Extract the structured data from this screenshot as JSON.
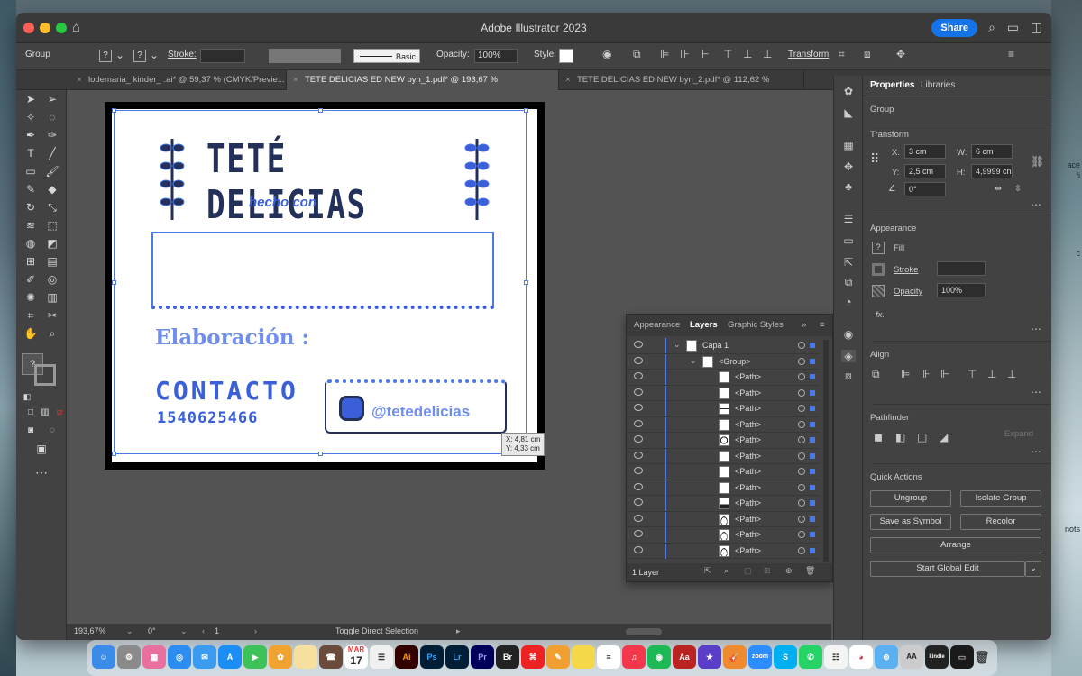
{
  "window": {
    "app_title": "Adobe Illustrator 2023",
    "share_label": "Share"
  },
  "control_bar": {
    "selection_label": "Group",
    "stroke_label": "Stroke:",
    "brush_label": "Basic",
    "opacity_label": "Opacity:",
    "opacity_value": "100%",
    "style_label": "Style:",
    "transform_label": "Transform"
  },
  "tabs": [
    {
      "label": "lodemaria_ kinder_ .ai* @ 59,37 % (CMYK/Previe...",
      "active": false
    },
    {
      "label": "TETE DELICIAS ED NEW byn_1.pdf* @ 193,67 % (CMYK/Preview)",
      "active": true
    },
    {
      "label": "TETE DELICIAS ED NEW byn_2.pdf* @ 112,62 % (CMYK/...",
      "active": false
    }
  ],
  "artwork": {
    "title": "TETÉ DELICIAS",
    "subtitle": "hecho con",
    "elaboracion": "Elaboración :",
    "contacto": "CONTACTO",
    "phone": "1540625466",
    "instagram": "@tetedelicias"
  },
  "cursor_tooltip": {
    "x": "X: 4,81 cm",
    "y": "Y: 4,33 cm"
  },
  "status_bar": {
    "zoom": "193,67%",
    "rotation": "0°",
    "artboard": "1",
    "tool_hint": "Toggle Direct Selection"
  },
  "layers_panel": {
    "tabs": [
      "Appearance",
      "Layers",
      "Graphic Styles"
    ],
    "active_tab": "Layers",
    "rows": [
      {
        "name": "Capa 1",
        "level": 0
      },
      {
        "name": "<Group>",
        "level": 1
      },
      {
        "name": "<Path>",
        "level": 2
      },
      {
        "name": "<Path>",
        "level": 2
      },
      {
        "name": "<Path>",
        "level": 2
      },
      {
        "name": "<Path>",
        "level": 2
      },
      {
        "name": "<Path>",
        "level": 2
      },
      {
        "name": "<Path>",
        "level": 2
      },
      {
        "name": "<Path>",
        "level": 2
      },
      {
        "name": "<Path>",
        "level": 2
      },
      {
        "name": "<Path>",
        "level": 2
      },
      {
        "name": "<Path>",
        "level": 2
      },
      {
        "name": "<Path>",
        "level": 2
      },
      {
        "name": "<Path>",
        "level": 2
      }
    ],
    "footer_label": "1 Layer"
  },
  "properties": {
    "tabs": [
      "Properties",
      "Libraries"
    ],
    "active_tab": "Properties",
    "object_type": "Group",
    "transform": {
      "title": "Transform",
      "x_label": "X:",
      "x_value": "3 cm",
      "y_label": "Y:",
      "y_value": "2,5 cm",
      "w_label": "W:",
      "w_value": "6 cm",
      "h_label": "H:",
      "h_value": "4,9999 cn",
      "angle_value": "0°"
    },
    "appearance": {
      "title": "Appearance",
      "fill_label": "Fill",
      "stroke_label": "Stroke",
      "opacity_label": "Opacity",
      "opacity_value": "100%",
      "fx_label": "fx."
    },
    "align": {
      "title": "Align"
    },
    "pathfinder": {
      "title": "Pathfinder",
      "expand_label": "Expand"
    },
    "quick_actions": {
      "title": "Quick Actions",
      "buttons": [
        "Ungroup",
        "Isolate Group",
        "Save as Symbol",
        "Recolor",
        "Arrange",
        "Start Global Edit"
      ]
    }
  },
  "desktop": {
    "edge_labels": [
      "ace",
      "fi",
      "c",
      "nots"
    ]
  },
  "dock": {
    "calendar_month": "MAR",
    "calendar_day": "17",
    "app_labels": [
      "Ai",
      "Ps",
      "Lr",
      "Pr",
      "Br",
      "Aa",
      "zoom",
      "kindle"
    ]
  },
  "colors": {
    "selection_blue": "#4b79e6",
    "ui_dark": "#424242",
    "canvas_gray": "#535353",
    "share_blue": "#1473e6"
  }
}
